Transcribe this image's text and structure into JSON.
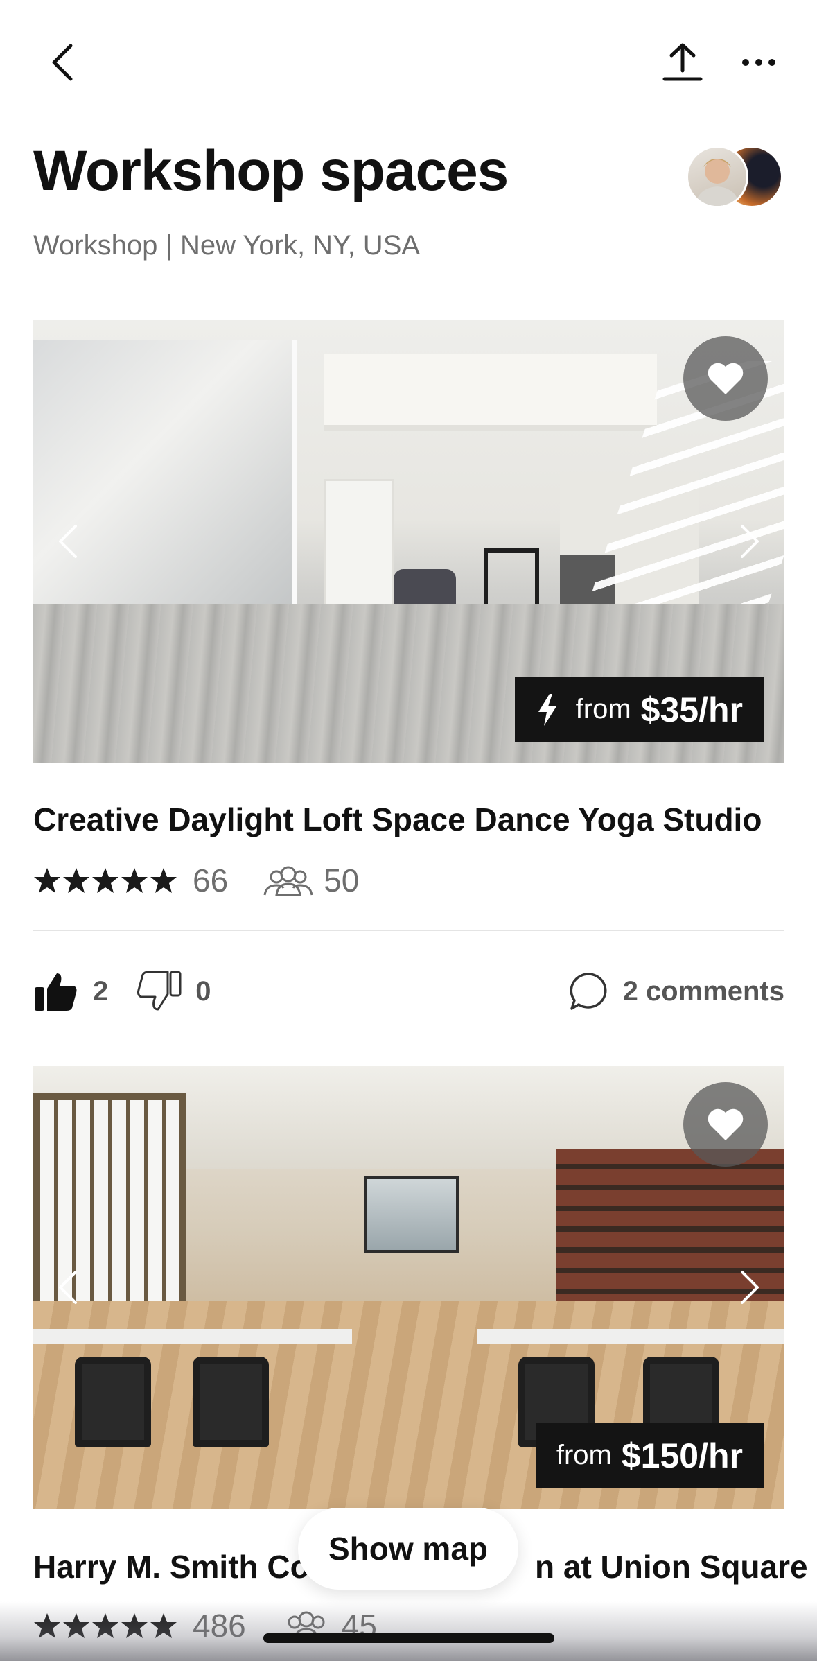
{
  "header": {
    "title": "Workshop spaces",
    "subtitle": "Workshop | New York, NY, USA",
    "back_icon": "chevron-left-icon",
    "share_icon": "share-upload-icon",
    "more_icon": "more-horizontal-icon"
  },
  "listings": [
    {
      "title": "Creative Daylight Loft Space Dance Yoga Studio",
      "price_prefix": "from",
      "price": "$35/hr",
      "instant_book": true,
      "rating_count": "66",
      "capacity": "50",
      "likes": "2",
      "dislikes": "0",
      "comments": "2 comments",
      "favorited": true
    },
    {
      "title_left": "Harry M. Smith Co",
      "title_right": "n at Union Square",
      "price_prefix": "from",
      "price": "$150/hr",
      "instant_book": false,
      "rating_count": "486",
      "capacity": "45",
      "favorited": true
    }
  ],
  "show_map": "Show map",
  "colors": {
    "text_primary": "#111111",
    "text_secondary": "#6e6e6e",
    "price_tag_bg": "#141414",
    "heart_bg": "#5a5a5a"
  }
}
